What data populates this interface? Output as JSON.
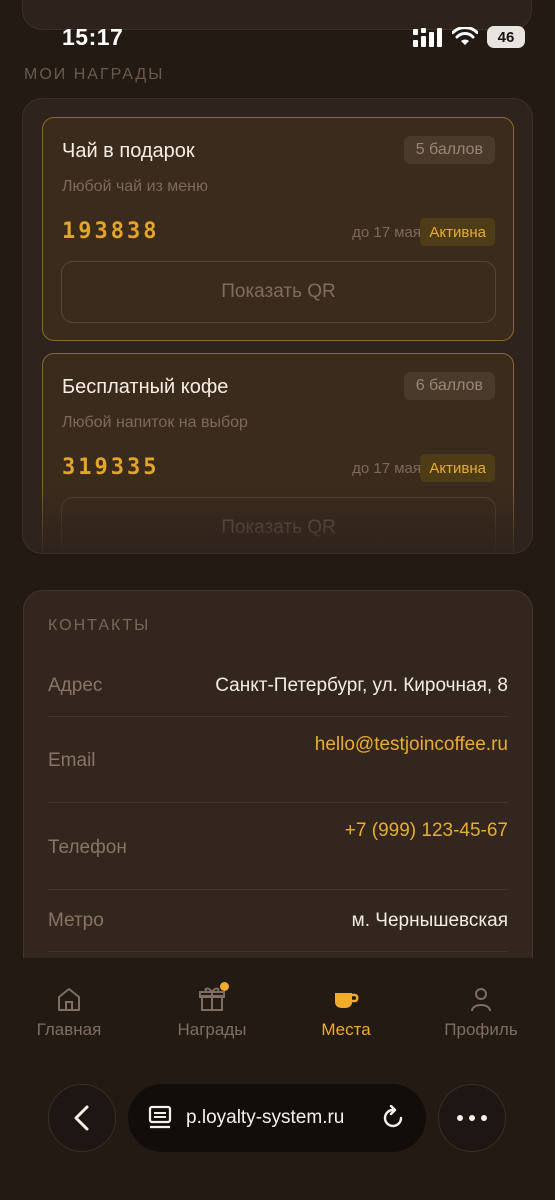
{
  "status_bar": {
    "time": "15:17",
    "battery": "46",
    "icons": [
      "cellular-icon",
      "wifi-icon",
      "battery-icon"
    ]
  },
  "rewards": {
    "section_title": "МОИ НАГРАДЫ",
    "items": [
      {
        "title": "Чай в подарок",
        "points": "5 баллов",
        "description": "Любой чай из меню",
        "code": "193838",
        "until": "до 17 мая",
        "status": "Активна",
        "button": "Показать QR"
      },
      {
        "title": "Бесплатный кофе",
        "points": "6 баллов",
        "description": "Любой напиток на выбор",
        "code": "319335",
        "until": "до 17 мая",
        "status": "Активна",
        "button": "Показать QR"
      }
    ]
  },
  "contacts": {
    "section_title": "КОНТАКТЫ",
    "rows": [
      {
        "label": "Адрес",
        "value": "Санкт-Петербург, ул. Кирочная, 8"
      },
      {
        "label": "Email",
        "value": "hello@testjoincoffee.ru"
      },
      {
        "label": "Телефон",
        "value": "+7 (999) 123-45-67"
      },
      {
        "label": "Метро",
        "value": "м. Чернышевская"
      }
    ]
  },
  "bottom_nav": {
    "items": [
      {
        "label": "Главная",
        "icon": "home-icon"
      },
      {
        "label": "Награды",
        "icon": "gift-icon"
      },
      {
        "label": "Места",
        "icon": "coffee-cup-icon"
      },
      {
        "label": "Профиль",
        "icon": "person-icon"
      }
    ],
    "active_index": 2
  },
  "browser": {
    "url": "p.loyalty-system.ru"
  },
  "colors": {
    "background": "#241a14",
    "accent": "#e7ad32",
    "card_border": "#8a6a28"
  }
}
